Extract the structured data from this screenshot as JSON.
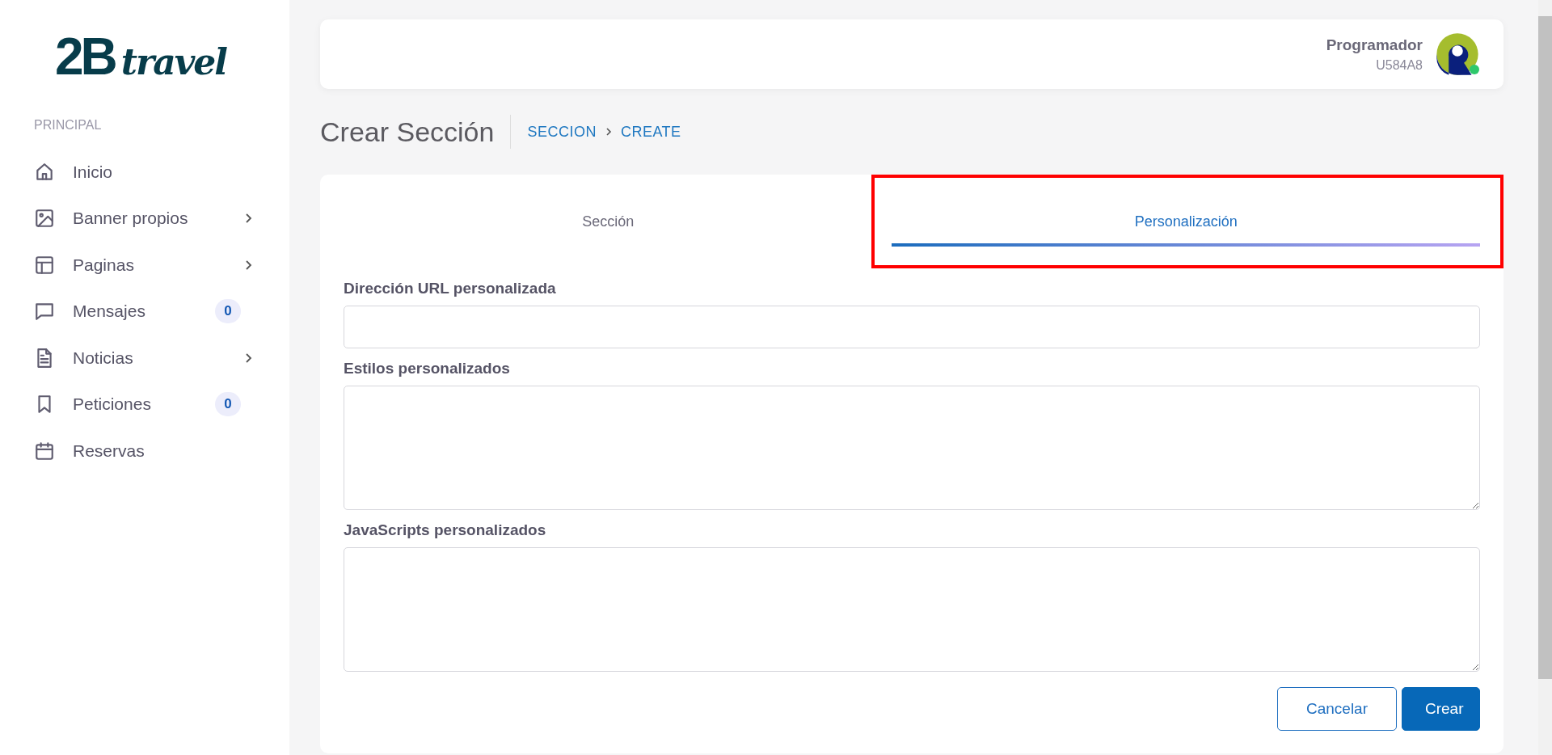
{
  "logo": {
    "mark": "2B",
    "word": "travel"
  },
  "sidebar": {
    "section": "PRINCIPAL",
    "items": [
      {
        "label": "Inicio",
        "kind": "home",
        "submenu": false
      },
      {
        "label": "Banner propios",
        "kind": "image",
        "submenu": true
      },
      {
        "label": "Paginas",
        "kind": "layout",
        "submenu": true
      },
      {
        "label": "Mensajes",
        "kind": "chat",
        "submenu": false,
        "badge": "0"
      },
      {
        "label": "Noticias",
        "kind": "doc",
        "submenu": true
      },
      {
        "label": "Peticiones",
        "kind": "bookmark",
        "submenu": false,
        "badge": "0"
      },
      {
        "label": "Reservas",
        "kind": "calendar",
        "submenu": false
      }
    ]
  },
  "header": {
    "user_name": "Programador",
    "user_code": "U584A8",
    "online": true
  },
  "page": {
    "title": "Crear Sección",
    "breadcrumb": [
      "SECCION",
      "CREATE"
    ]
  },
  "tabs": [
    {
      "label": "Sección",
      "selected": false
    },
    {
      "label": "Personalización",
      "selected": true
    }
  ],
  "fields": [
    {
      "label": "Dirección URL personalizada",
      "kind": "input"
    },
    {
      "label": "Estilos personalizados",
      "kind": "textarea"
    },
    {
      "label": "JavaScripts personalizados",
      "kind": "textarea"
    }
  ],
  "buttons": [
    {
      "label": "Cancelar",
      "kind": "outline"
    },
    {
      "label": "Crear",
      "kind": "primary"
    }
  ]
}
